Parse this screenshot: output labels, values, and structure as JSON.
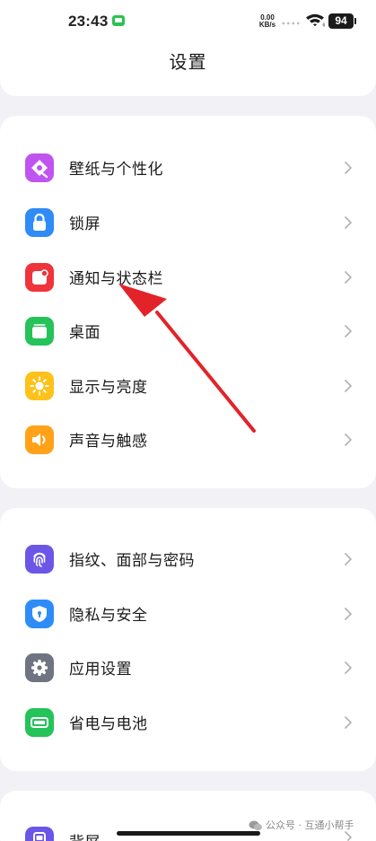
{
  "status_bar": {
    "time": "23:43",
    "net_speed_value": "0.00",
    "net_speed_unit": "KB/s",
    "battery": "94"
  },
  "header": {
    "title": "设置"
  },
  "colors": {
    "wallpaper": "#c054f0",
    "lock": "#2f8cf7",
    "notification": "#f0343c",
    "desktop": "#26c25a",
    "display": "#ffc21a",
    "sound": "#ffa21a",
    "fingerprint": "#6b56e8",
    "privacy": "#2f8cf7",
    "apps": "#6f7480",
    "battery": "#26c25a",
    "back_screen": "#6b56e8",
    "arrow": "#e2232a"
  },
  "groups": [
    {
      "items": [
        {
          "label": "壁纸与个性化",
          "icon": "wallpaper-icon"
        },
        {
          "label": "锁屏",
          "icon": "lock-icon"
        },
        {
          "label": "通知与状态栏",
          "icon": "notification-icon"
        },
        {
          "label": "桌面",
          "icon": "desktop-icon"
        },
        {
          "label": "显示与亮度",
          "icon": "brightness-icon"
        },
        {
          "label": "声音与触感",
          "icon": "sound-icon"
        }
      ]
    },
    {
      "items": [
        {
          "label": "指纹、面部与密码",
          "icon": "fingerprint-icon"
        },
        {
          "label": "隐私与安全",
          "icon": "shield-icon"
        },
        {
          "label": "应用设置",
          "icon": "gear-icon"
        },
        {
          "label": "省电与电池",
          "icon": "battery-icon"
        }
      ]
    },
    {
      "items": [
        {
          "label": "背屏",
          "icon": "back-screen-icon"
        }
      ]
    }
  ],
  "watermark": {
    "text": "公众号 · 互通小帮手"
  }
}
